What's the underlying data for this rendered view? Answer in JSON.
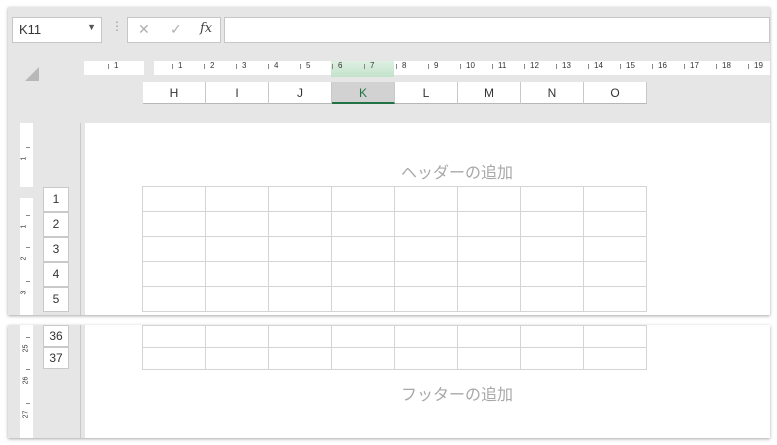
{
  "name_box": {
    "value": "K11",
    "dropdown_icon": "triangle-down-icon"
  },
  "formula_bar": {
    "cancel_icon": "cancel-x-icon",
    "enter_icon": "check-icon",
    "function_label": "fx",
    "value": ""
  },
  "ruler": {
    "numbers": [
      "1",
      "1",
      "2",
      "3",
      "4",
      "5",
      "6",
      "7",
      "8",
      "9",
      "10",
      "11",
      "12",
      "13",
      "14",
      "15",
      "16",
      "17",
      "18",
      "19"
    ]
  },
  "columns": [
    "H",
    "I",
    "J",
    "K",
    "L",
    "M",
    "N",
    "O"
  ],
  "active_column": "K",
  "rows_top": [
    "1",
    "2",
    "3",
    "4",
    "5"
  ],
  "rows_bottom": [
    "36",
    "37"
  ],
  "vruler_top": [
    "1",
    "1",
    "2",
    "3"
  ],
  "vruler_bottom": [
    "25",
    "26",
    "27"
  ],
  "header_placeholder": "ヘッダーの追加",
  "footer_placeholder": "フッターの追加",
  "colors": {
    "accent": "#217346",
    "active_col_bg": "#d2d2d2",
    "ruler_highlight": "#c2e2cb"
  }
}
